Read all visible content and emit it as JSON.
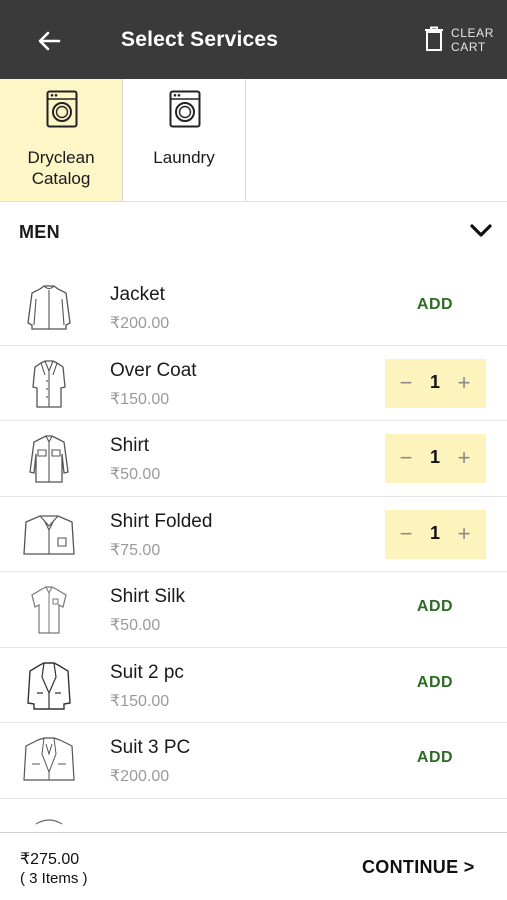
{
  "header": {
    "title": "Select Services",
    "back_icon": "arrow-left-icon",
    "clear_cart_line1": "CLEAR",
    "clear_cart_line2": "CART",
    "clear_cart_icon": "trash-icon"
  },
  "tabs": [
    {
      "label_line1": "Dryclean",
      "label_line2": "Catalog",
      "icon": "washing-machine-icon",
      "active": true
    },
    {
      "label_line1": "Laundry",
      "label_line2": "",
      "icon": "washing-machine-icon",
      "active": false
    }
  ],
  "section": {
    "title": "MEN",
    "icon": "chevron-down-icon"
  },
  "items": [
    {
      "name": "Jacket",
      "price": "₹200.00",
      "icon": "jacket-icon",
      "action": "ADD"
    },
    {
      "name": "Over Coat",
      "price": "₹150.00",
      "icon": "overcoat-icon",
      "quantity": "1"
    },
    {
      "name": "Shirt",
      "price": "₹50.00",
      "icon": "shirt-icon",
      "quantity": "1"
    },
    {
      "name": "Shirt Folded",
      "price": "₹75.00",
      "icon": "folded-shirt-icon",
      "quantity": "1"
    },
    {
      "name": "Shirt Silk",
      "price": "₹50.00",
      "icon": "silk-shirt-icon",
      "action": "ADD"
    },
    {
      "name": "Suit 2 pc",
      "price": "₹150.00",
      "icon": "suit-icon",
      "action": "ADD"
    },
    {
      "name": "Suit 3 PC",
      "price": "₹200.00",
      "icon": "three-piece-suit-icon",
      "action": "ADD"
    }
  ],
  "stepper": {
    "minus": "−",
    "plus": "+"
  },
  "footer": {
    "total": "₹275.00",
    "items_count": "( 3 Items )",
    "continue_label": "CONTINUE >"
  },
  "colors": {
    "header_bg": "#3a3a3a",
    "active_tab_bg": "#fdf6c7",
    "stepper_bg": "#fdf3bd",
    "add_text": "#2e6b24",
    "price_text": "#9a9a9a"
  }
}
